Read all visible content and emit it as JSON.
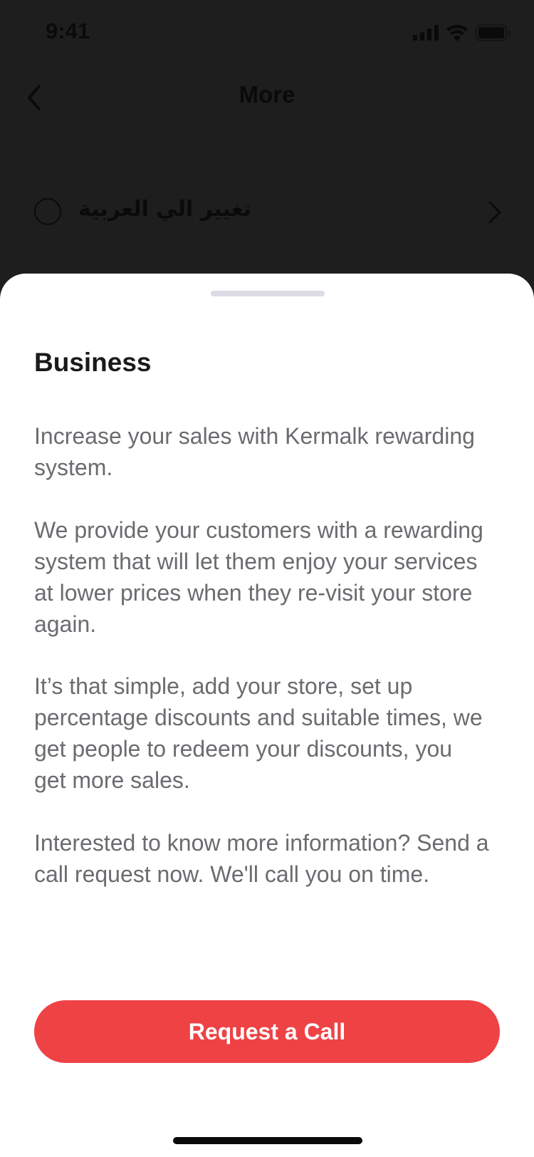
{
  "status_bar": {
    "time": "9:41"
  },
  "nav": {
    "title": "More"
  },
  "language_row": {
    "label": "تغيير الي العربية"
  },
  "sheet": {
    "title": "Business",
    "paragraphs": [
      "Increase your sales with Kermalk rewarding system.",
      "We provide your customers with a rewarding system that will let them enjoy your services at lower prices when they re-visit your store again.",
      "It’s that simple, add your store, set up percentage discounts and suitable times, we get people to redeem your discounts, you get more sales.",
      "Interested to know more information? Send a call request now. We'll call you on time."
    ],
    "cta_label": "Request a Call"
  },
  "colors": {
    "accent": "#ee4245",
    "overlay_background": "#1e1e1e",
    "sheet_background": "#ffffff",
    "body_text": "#6b6b70"
  },
  "icons": {
    "back": "chevron-left-icon",
    "language": "globe-icon",
    "row_chevron": "chevron-right-icon",
    "signal": "cellular-signal-icon",
    "wifi": "wifi-icon",
    "battery": "battery-icon"
  }
}
